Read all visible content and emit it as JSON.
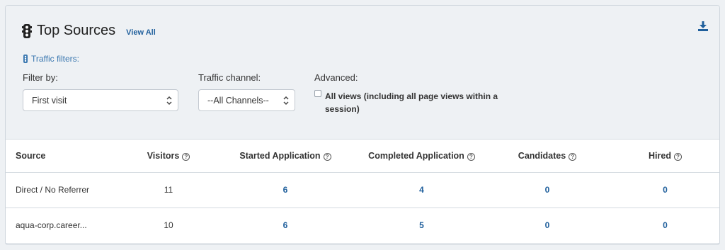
{
  "header": {
    "title": "Top Sources",
    "view_all_label": "View All",
    "title_icon": "traffic-light-icon",
    "download_icon": "download-icon"
  },
  "filters": {
    "section_label": "Traffic filters:",
    "filter_by": {
      "label": "Filter by:",
      "value": "First visit"
    },
    "traffic_channel": {
      "label": "Traffic channel:",
      "value": "--All Channels--"
    },
    "advanced": {
      "label": "Advanced:",
      "checkbox_label": "All views (including all page views within a session)",
      "checked": false
    }
  },
  "table": {
    "columns": [
      "Source",
      "Visitors",
      "Started Application",
      "Completed Application",
      "Candidates",
      "Hired"
    ],
    "rows": [
      {
        "source": "Direct / No Referrer",
        "visitors": "11",
        "started": "6",
        "completed": "4",
        "candidates": "0",
        "hired": "0"
      },
      {
        "source": "aqua-corp.career...",
        "visitors": "10",
        "started": "6",
        "completed": "5",
        "candidates": "0",
        "hired": "0"
      }
    ]
  },
  "colors": {
    "accent": "#1f5f9c",
    "panel_bg": "#eef1f4"
  }
}
